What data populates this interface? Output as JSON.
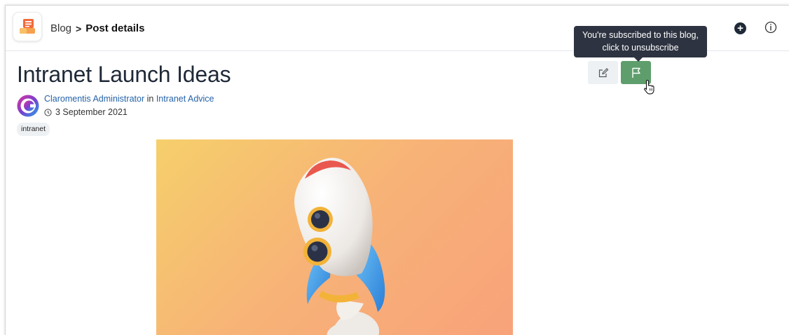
{
  "header": {
    "breadcrumb": {
      "parent": "Blog",
      "separator": ">",
      "current": "Post details"
    },
    "add_icon": "plus-circle-icon",
    "info_icon": "info-circle-icon"
  },
  "tooltip": {
    "text": "You're subscribed to this blog, click to unsubscribe"
  },
  "post": {
    "title": "Intranet Launch Ideas",
    "author": "Claromentis Administrator",
    "in_word": "in",
    "category": "Intranet Advice",
    "date": "3 September 2021",
    "tag": "intranet"
  },
  "actions": {
    "edit_icon": "edit-icon",
    "subscribe_icon": "flag-icon",
    "subscribe_color": "#5e9e6c"
  },
  "colors": {
    "link": "#2563a8",
    "title": "#1f2937",
    "tooltip_bg": "#2d3340"
  }
}
